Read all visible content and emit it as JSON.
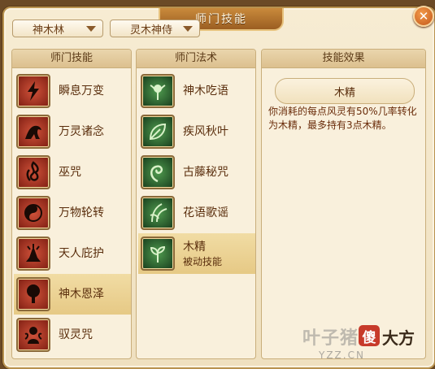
{
  "window": {
    "title": "师门技能"
  },
  "dropdowns": {
    "sect": "神木林",
    "job": "灵木神侍"
  },
  "panels": {
    "skills_header": "师门技能",
    "spells_header": "师门法术",
    "effect_header": "技能效果"
  },
  "skills": [
    {
      "label": "瞬息万变",
      "icon": "lightning-icon"
    },
    {
      "label": "万灵诸念",
      "icon": "beast-icon"
    },
    {
      "label": "巫咒",
      "icon": "flame-icon"
    },
    {
      "label": "万物轮转",
      "icon": "taiji-icon"
    },
    {
      "label": "天人庇护",
      "icon": "praying-hands-icon"
    },
    {
      "label": "神木恩泽",
      "icon": "tree-icon",
      "selected": true
    },
    {
      "label": "驭灵咒",
      "icon": "spirit-icon"
    }
  ],
  "spells": [
    {
      "label": "神木吃语",
      "icon": "sprite-icon"
    },
    {
      "label": "疾风秋叶",
      "icon": "leaf-icon"
    },
    {
      "label": "古藤秘咒",
      "icon": "vine-icon"
    },
    {
      "label": "花语歌谣",
      "icon": "grass-icon"
    },
    {
      "label": "木精",
      "sub": "被动技能",
      "icon": "sprout-icon",
      "selected": true
    }
  ],
  "effect": {
    "name": "木精",
    "description": "你消耗的每点风灵有50%几率转化为木精，最多持有3点木精。"
  },
  "watermark": {
    "text": "叶子猪",
    "badge": "傻",
    "dafang": "大方",
    "url": "YZZ.CN"
  },
  "colors": {
    "selected_row": "#e6c985",
    "text": "#5a2e0d",
    "skill_icon": "#a03322",
    "spell_icon": "#2e6a2f"
  }
}
